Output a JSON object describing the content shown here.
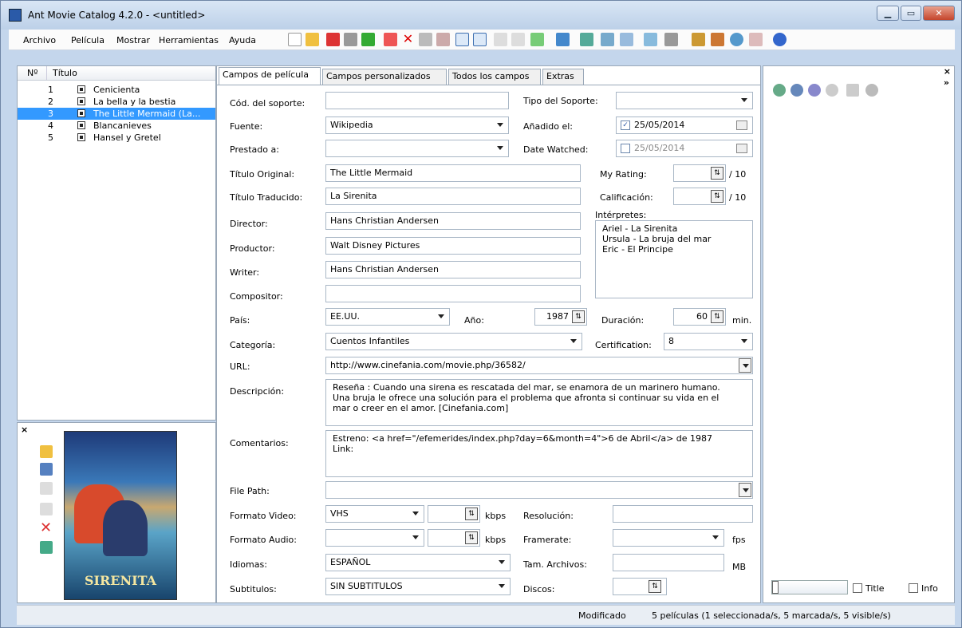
{
  "window": {
    "title": "Ant Movie Catalog 4.2.0 - <untitled>",
    "minimize": "▭",
    "maximize": "▭",
    "close": "X"
  },
  "menu": [
    "Archivo",
    "Película",
    "Mostrar",
    "Herramientas",
    "Ayuda"
  ],
  "list": {
    "col_no": "Nº",
    "col_title": "Título",
    "rows": [
      {
        "no": "1",
        "title": "Cenicienta"
      },
      {
        "no": "2",
        "title": "La bella y la bestia"
      },
      {
        "no": "3",
        "title": "The Little Mermaid (La..."
      },
      {
        "no": "4",
        "title": "Blancanieves"
      },
      {
        "no": "5",
        "title": "Hansel y Gretel"
      }
    ]
  },
  "poster": {
    "text": "SIRENITA"
  },
  "tabs": [
    "Campos de película",
    "Campos personalizados",
    "Todos los campos",
    "Extras"
  ],
  "labels": {
    "cod_soporte": "Cód. del soporte:",
    "tipo_soporte": "Tipo del Soporte:",
    "fuente": "Fuente:",
    "anadido": "Añadido el:",
    "prestado": "Prestado a:",
    "date_watched": "Date Watched:",
    "titulo_original": "Título Original:",
    "my_rating": "My Rating:",
    "titulo_traducido": "Título Traducido:",
    "calificacion": "Calificación:",
    "director": "Director:",
    "interpretes": "Intérpretes:",
    "productor": "Productor:",
    "writer": "Writer:",
    "compositor": "Compositor:",
    "pais": "País:",
    "ano": "Año:",
    "duracion": "Duración:",
    "min": "min.",
    "categoria": "Categoría:",
    "certification": "Certification:",
    "url": "URL:",
    "descripcion": "Descripción:",
    "comentarios": "Comentarios:",
    "file_path": "File Path:",
    "formato_video": "Formato Video:",
    "kbps": "kbps",
    "resolucion": "Resolución:",
    "formato_audio": "Formato Audio:",
    "framerate": "Framerate:",
    "fps": "fps",
    "idiomas": "Idiomas:",
    "tam_archivos": "Tam. Archivos:",
    "mb": "MB",
    "subtitulos": "Subtitulos:",
    "discos": "Discos:",
    "slash10": "/ 10"
  },
  "values": {
    "fuente": "Wikipedia",
    "anadido": "25/05/2014",
    "date_watched": "25/05/2014",
    "titulo_original": "The Little Mermaid",
    "titulo_traducido": "La Sirenita",
    "director": "Hans Christian Andersen",
    "productor": "Walt Disney Pictures",
    "writer": "Hans Christian Andersen",
    "interpretes": "Ariel - La Sirenita\nUrsula - La bruja del mar\nEric - El Principe",
    "pais": "EE.UU.",
    "ano": "1987",
    "duracion": "60",
    "categoria": "Cuentos Infantiles",
    "certification": "8",
    "url": "http://www.cinefania.com/movie.php/36582/",
    "descripcion": "Reseña :  Cuando una sirena es rescatada del mar, se enamora de un marinero humano. Una bruja le ofrece una solución para el problema que afronta si continuar su vida en el mar o creer en el amor. [Cinefania.com]",
    "comentarios": "Estreno: <a href=\"/efemerides/index.php?day=6&month=4\">6 de Abril</a> de 1987\nLink:",
    "formato_video": "VHS",
    "idiomas": "ESPAÑOL",
    "subtitulos": "SIN SUBTITULOS"
  },
  "right": {
    "title_label": "Title",
    "info_label": "Info"
  },
  "status": {
    "state": "Modificado",
    "summary": "5 películas (1 seleccionada/s, 5 marcada/s, 5 visible/s)"
  }
}
